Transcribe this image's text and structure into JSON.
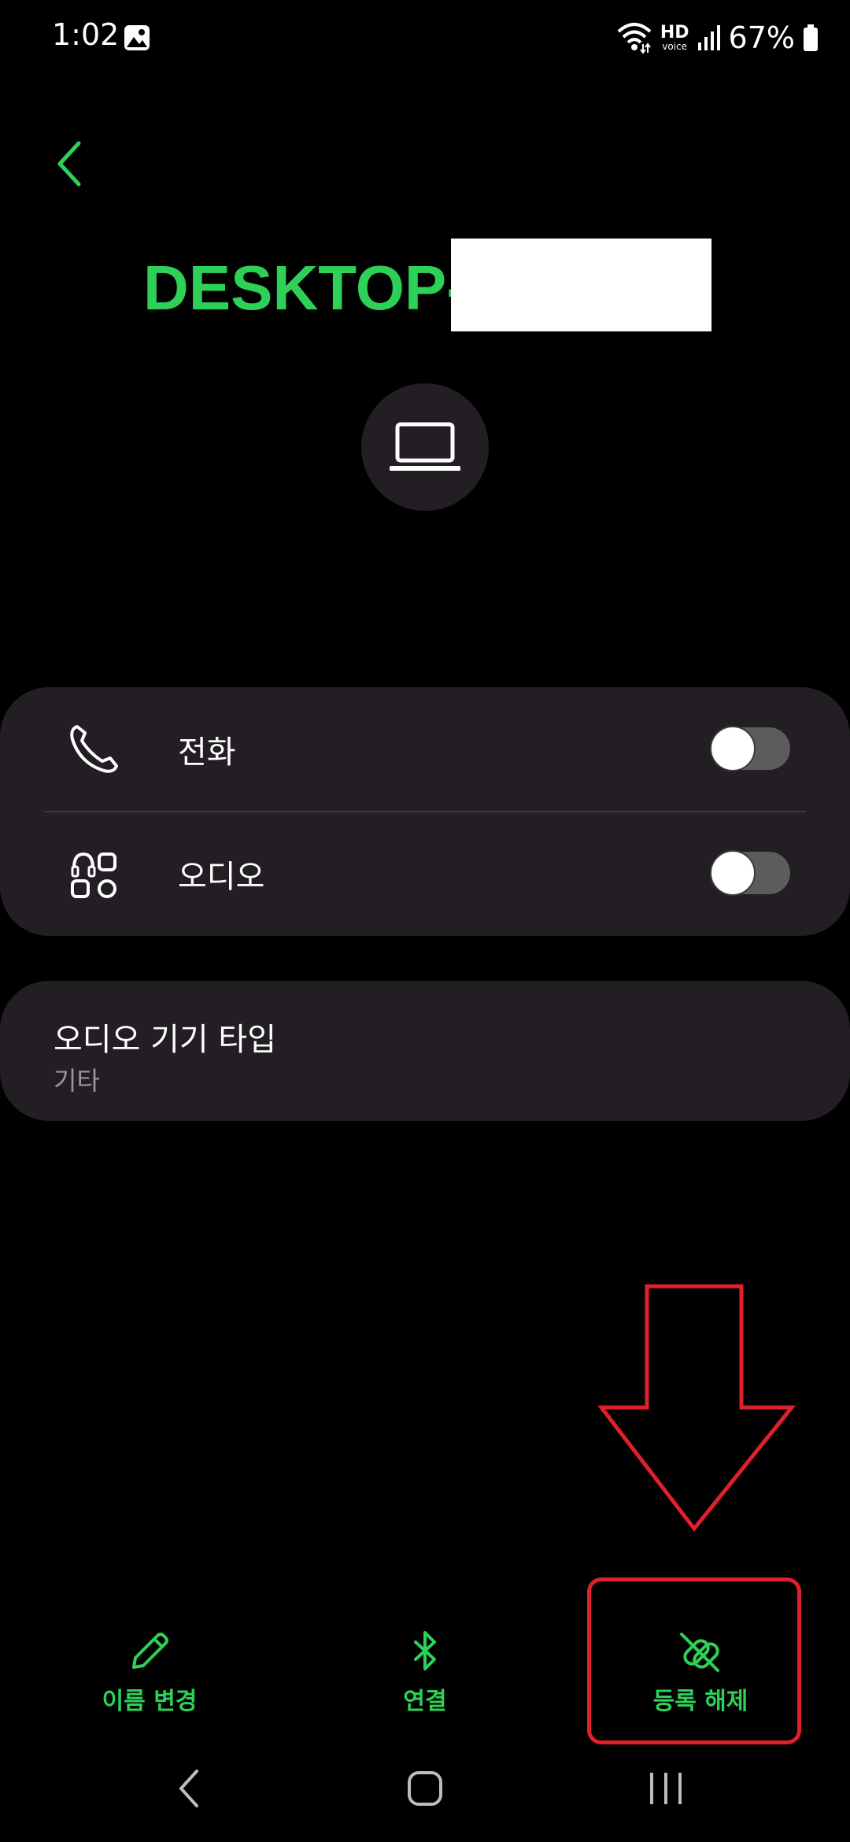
{
  "status_bar": {
    "time": "1:02",
    "battery": "67%",
    "hd_label": "HD",
    "voice_label": "voice"
  },
  "device": {
    "name": "DESKTOP-"
  },
  "profiles": [
    {
      "label": "전화",
      "icon": "phone-icon",
      "enabled": false
    },
    {
      "label": "오디오",
      "icon": "audio-apps-icon",
      "enabled": false
    }
  ],
  "audio_type": {
    "title": "오디오 기기 타입",
    "value": "기타"
  },
  "actions": {
    "rename": "이름 변경",
    "connect": "연결",
    "unpair": "등록 해제"
  },
  "colors": {
    "accent": "#2ed158",
    "card_bg": "#221e23",
    "annotation": "#e0202a"
  }
}
